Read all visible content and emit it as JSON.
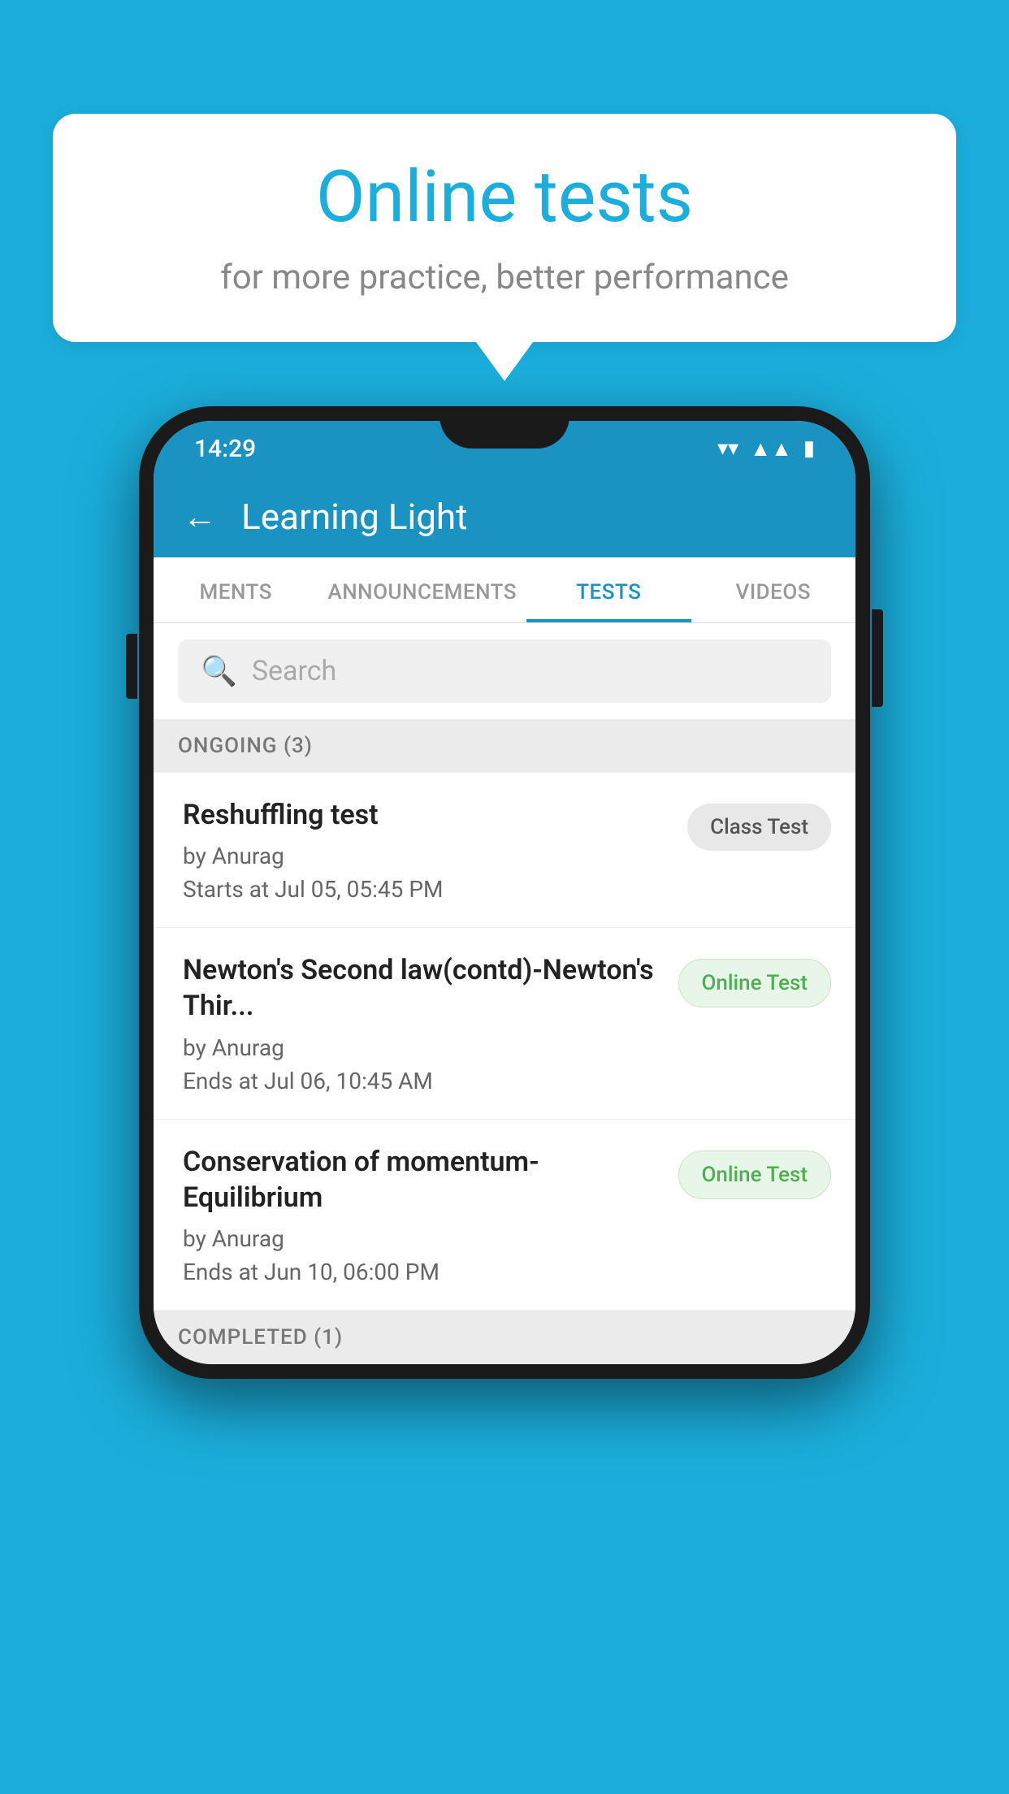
{
  "background_color": "#1BAEDC",
  "bubble": {
    "title": "Online tests",
    "subtitle": "for more practice, better performance"
  },
  "phone": {
    "status_bar": {
      "time": "14:29",
      "wifi": "▼",
      "signal": "▲",
      "battery": "▮"
    },
    "header": {
      "back_label": "←",
      "title": "Learning Light"
    },
    "tabs": [
      {
        "label": "MENTS",
        "active": false
      },
      {
        "label": "ANNOUNCEMENTS",
        "active": false
      },
      {
        "label": "TESTS",
        "active": true
      },
      {
        "label": "VIDEOS",
        "active": false
      }
    ],
    "search": {
      "placeholder": "Search"
    },
    "sections": [
      {
        "label": "ONGOING (3)",
        "items": [
          {
            "title": "Reshuffling test",
            "author": "by Anurag",
            "time": "Starts at  Jul 05, 05:45 PM",
            "badge": "Class Test",
            "badge_type": "class"
          },
          {
            "title": "Newton's Second law(contd)-Newton's Thir...",
            "author": "by Anurag",
            "time": "Ends at  Jul 06, 10:45 AM",
            "badge": "Online Test",
            "badge_type": "online"
          },
          {
            "title": "Conservation of momentum-Equilibrium",
            "author": "by Anurag",
            "time": "Ends at  Jun 10, 06:00 PM",
            "badge": "Online Test",
            "badge_type": "online"
          }
        ]
      }
    ],
    "completed_section_label": "COMPLETED (1)"
  }
}
